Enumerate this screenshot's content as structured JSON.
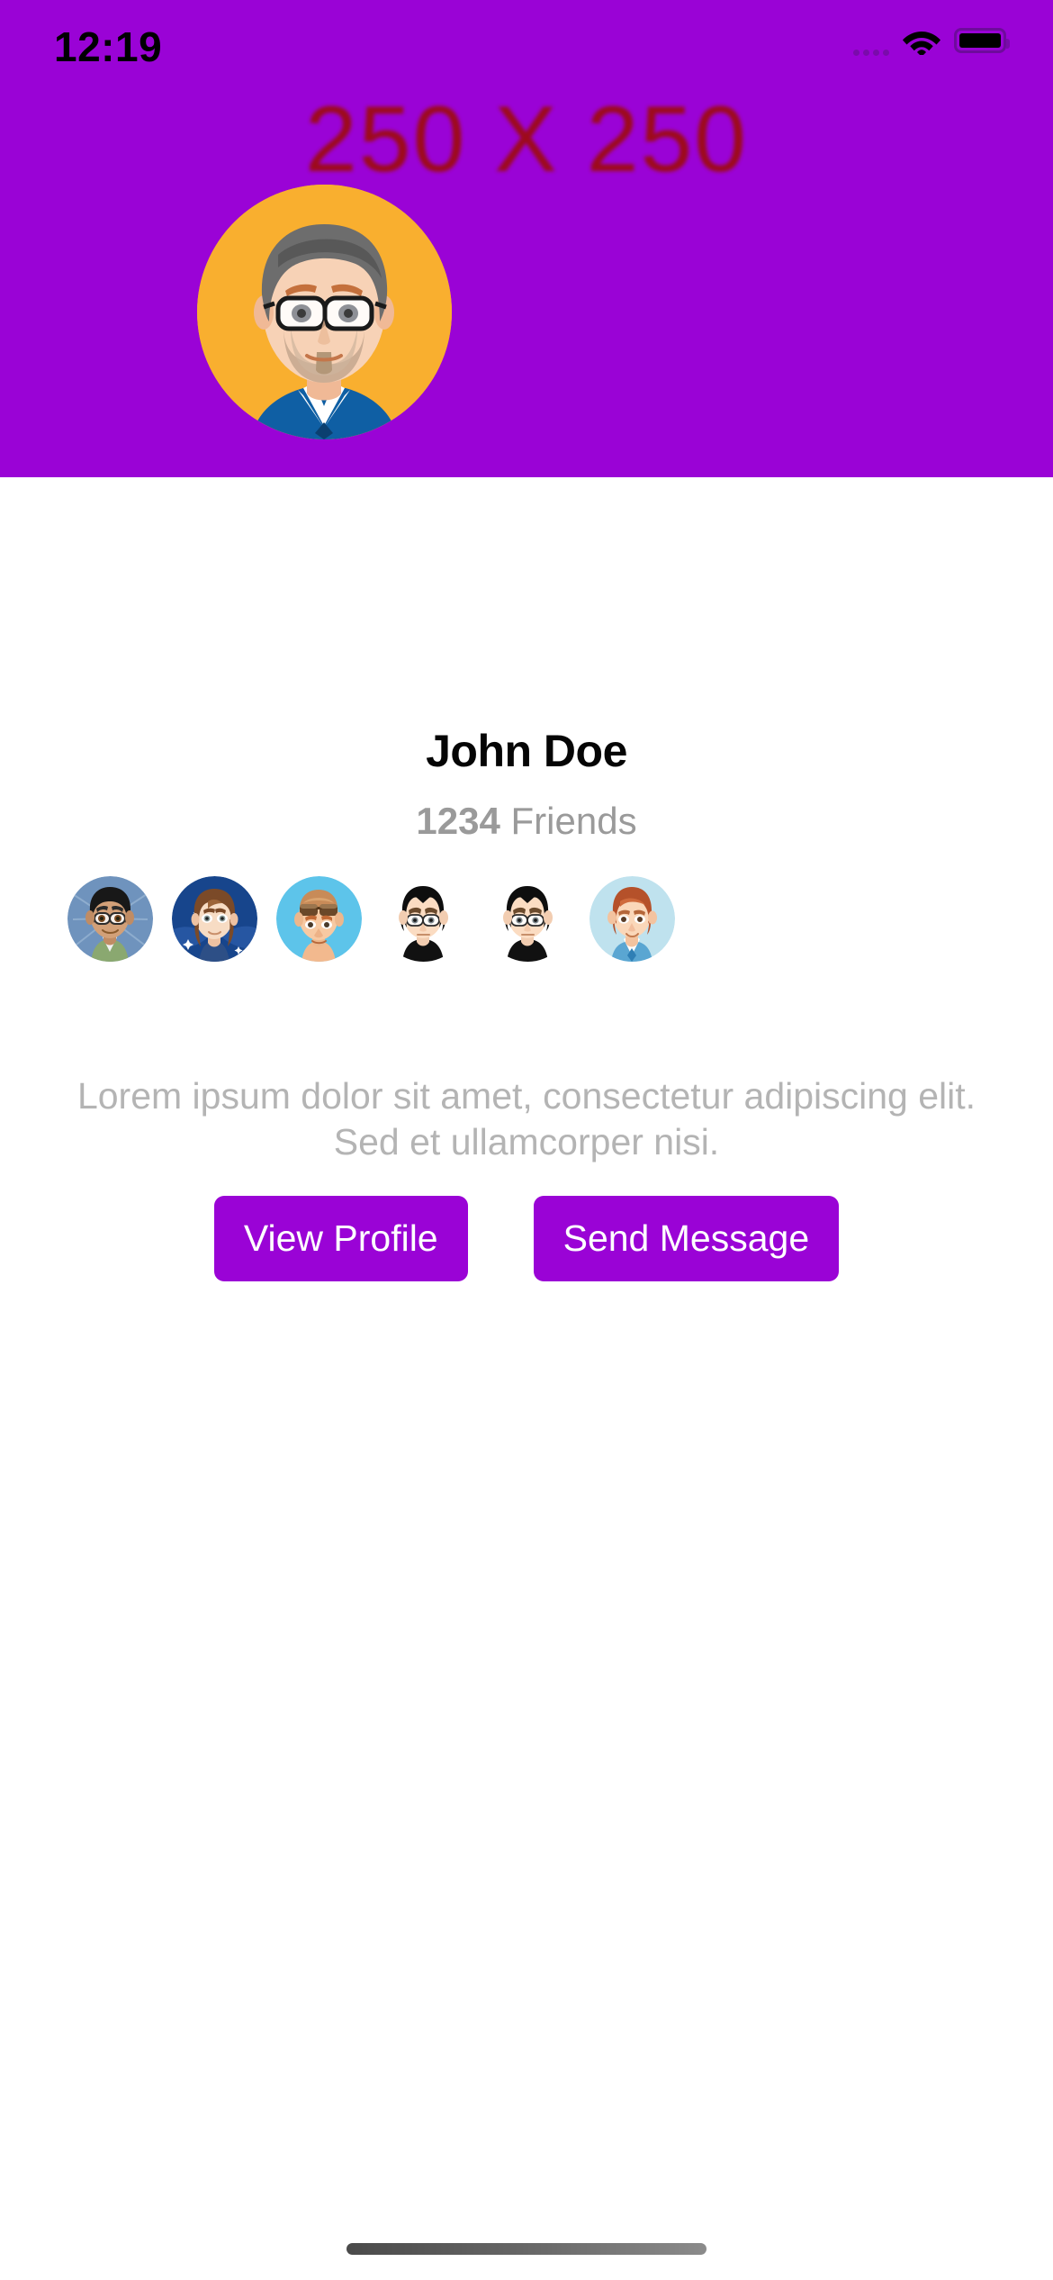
{
  "status_bar": {
    "time": "12:19",
    "signal_icon": "signal-dots-icon",
    "wifi_icon": "wifi-icon",
    "battery_icon": "battery-full-icon"
  },
  "header": {
    "placeholder_label": "250 X 250",
    "background_color": "#9a03d6",
    "placeholder_text_color": "#9e0b0b"
  },
  "profile": {
    "avatar_icon": "user-avatar-large",
    "avatar_background_color": "#f9af2f",
    "name": "John Doe",
    "friends_count": "1234",
    "friends_label": "Friends",
    "bio": "Lorem ipsum dolor sit amet, consectetur adipiscing elit. Sed et ullamcorper nisi."
  },
  "friends": [
    {
      "icon": "friend-avatar-1",
      "background_color": "#6f93bd"
    },
    {
      "icon": "friend-avatar-2",
      "background_color": "#17458c"
    },
    {
      "icon": "friend-avatar-3",
      "background_color": "#5dc4ea"
    },
    {
      "icon": "friend-avatar-4",
      "background_color": "#ffffff"
    },
    {
      "icon": "friend-avatar-5",
      "background_color": "#ffffff"
    },
    {
      "icon": "friend-avatar-6",
      "background_color": "#bfe2ee"
    }
  ],
  "actions": {
    "view_profile_label": "View Profile",
    "send_message_label": "Send Message",
    "button_color": "#9a03d6",
    "button_text_color": "#ffffff"
  },
  "home_indicator": {
    "name": "home-indicator"
  }
}
